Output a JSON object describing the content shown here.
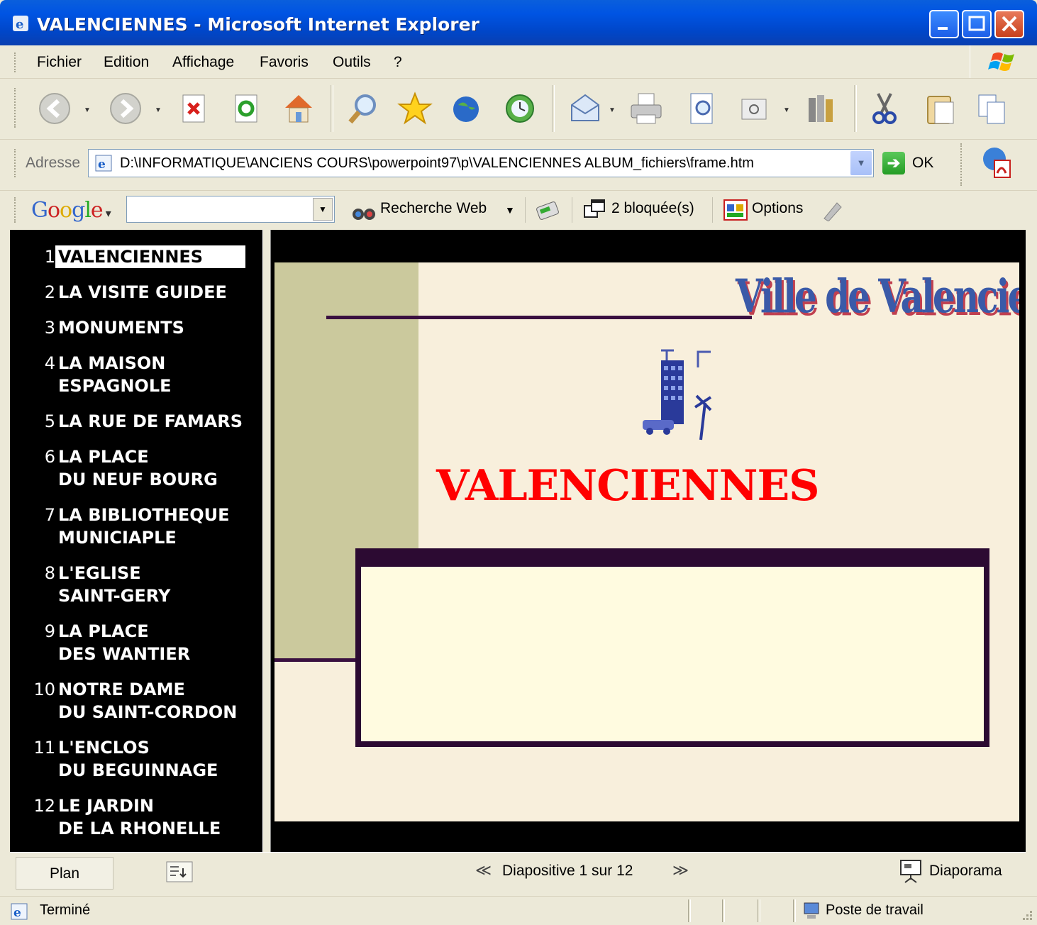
{
  "window": {
    "title": "VALENCIENNES - Microsoft Internet Explorer"
  },
  "menubar": {
    "items": [
      "Fichier",
      "Edition",
      "Affichage",
      "Favoris",
      "Outils",
      "?"
    ]
  },
  "address": {
    "label": "Adresse",
    "url": "D:\\INFORMATIQUE\\ANCIENS COURS\\powerpoint97\\p\\VALENCIENNES ALBUM_fichiers\\frame.htm",
    "go_label": "OK"
  },
  "googlebar": {
    "search_value": "",
    "search_web_label": "Recherche Web",
    "blocked_label": "2 bloquée(s)",
    "options_label": "Options"
  },
  "outline": {
    "items": [
      {
        "num": "1",
        "text": "VALENCIENNES",
        "selected": true
      },
      {
        "num": "2",
        "text": "LA VISITE GUIDEE"
      },
      {
        "num": "3",
        "text": "MONUMENTS"
      },
      {
        "num": "4",
        "text": "LA MAISON\nESPAGNOLE"
      },
      {
        "num": "5",
        "text": "LA RUE DE FAMARS"
      },
      {
        "num": "6",
        "text": "LA PLACE\nDU NEUF BOURG"
      },
      {
        "num": "7",
        "text": "LA BIBLIOTHEQUE\nMUNICIAPLE"
      },
      {
        "num": "8",
        "text": "L'EGLISE\nSAINT-GERY"
      },
      {
        "num": "9",
        "text": "LA PLACE\nDES WANTIER"
      },
      {
        "num": "10",
        "text": "NOTRE DAME\nDU SAINT-CORDON"
      },
      {
        "num": "11",
        "text": "L'ENCLOS\nDU BEGUINNAGE"
      },
      {
        "num": "12",
        "text": "LE JARDIN\nDE LA RHONELLE"
      }
    ]
  },
  "slide": {
    "brand": "Ville de Valenciennes",
    "title": "VALENCIENNES",
    "colors": {
      "title": "#ff0000",
      "band": "#cbc99d",
      "box_border": "#2c0a32",
      "box_fill": "#fffbe0"
    }
  },
  "nav": {
    "plan_label": "Plan",
    "slide_indicator": "Diapositive 1 sur 12",
    "slideshow_label": "Diaporama"
  },
  "status": {
    "text": "Terminé",
    "zone": "Poste de travail"
  }
}
